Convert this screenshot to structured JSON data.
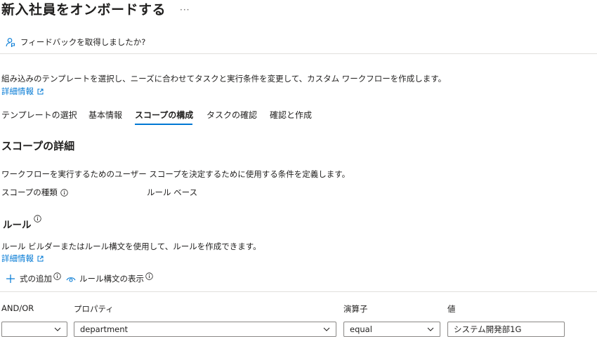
{
  "header": {
    "title": "新入社員をオンボードする",
    "more_label": "···"
  },
  "feedback": {
    "label": "フィードバックを取得しましたか?",
    "icon": "feedback-person-icon"
  },
  "intro": {
    "text": "組み込みのテンプレートを選択し、ニーズに合わせてタスクと実行条件を変更して、カスタム ワークフローを作成します。",
    "learn_more": "詳細情報"
  },
  "tabs": [
    {
      "label": "テンプレートの選択",
      "active": false
    },
    {
      "label": "基本情報",
      "active": false
    },
    {
      "label": "スコープの構成",
      "active": true
    },
    {
      "label": "タスクの確認",
      "active": false
    },
    {
      "label": "確認と作成",
      "active": false
    }
  ],
  "scope": {
    "heading": "スコープの詳細",
    "description": "ワークフローを実行するためのユーザー スコープを決定するために使用する条件を定義します。",
    "type_label": "スコープの種類",
    "type_value": "ルール ベース"
  },
  "rules": {
    "heading": "ルール",
    "description": "ルール ビルダーまたはルール構文を使用して、ルールを作成できます。",
    "learn_more": "詳細情報",
    "add_expression": "式の追加",
    "show_syntax": "ルール構文の表示"
  },
  "table": {
    "columns": [
      "AND/OR",
      "プロパティ",
      "演算子",
      "値"
    ],
    "row": {
      "and_or": "",
      "property": "department",
      "operator": "equal",
      "value": "システム開発部1G"
    }
  },
  "colors": {
    "accent": "#0078d4",
    "text": "#201f1e",
    "border": "#8a8886",
    "divider": "#e1dfdd"
  }
}
